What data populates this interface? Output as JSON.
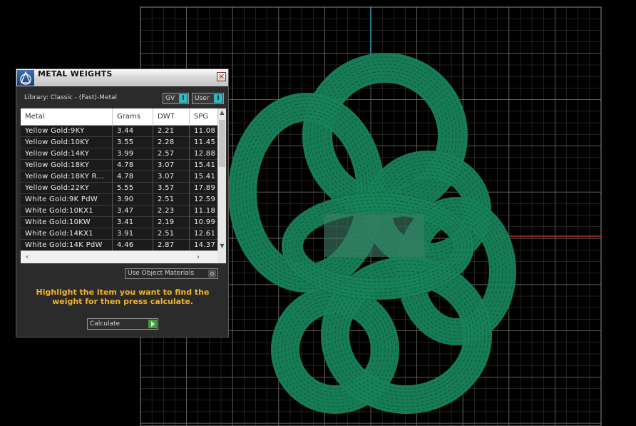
{
  "panel": {
    "title": "METAL WEIGHTS",
    "close_glyph": "✕",
    "library_label": "Library: Classic - (Fast)-Metal",
    "gv_toggle": "GV",
    "user_toggle": "User",
    "columns": [
      "Metal",
      "Grams",
      "DWT",
      "SPG"
    ],
    "rows": [
      [
        "Yellow Gold:9KY",
        "3.44",
        "2.21",
        "11.08"
      ],
      [
        "Yellow Gold:10KY",
        "3.55",
        "2.28",
        "11.45"
      ],
      [
        "Yellow Gold:14KY",
        "3.99",
        "2.57",
        "12.88"
      ],
      [
        "Yellow Gold:18KY",
        "4.78",
        "3.07",
        "15.41"
      ],
      [
        "Yellow Gold:18KY R...",
        "4.78",
        "3.07",
        "15.41"
      ],
      [
        "Yellow Gold:22KY",
        "5.55",
        "3.57",
        "17.89"
      ],
      [
        "White Gold:9K PdW",
        "3.90",
        "2.51",
        "12.59"
      ],
      [
        "White Gold:10KX1",
        "3.47",
        "2.23",
        "11.18"
      ],
      [
        "White Gold:10KW",
        "3.41",
        "2.19",
        "10.99"
      ],
      [
        "White Gold:14KX1",
        "3.91",
        "2.51",
        "12.61"
      ],
      [
        "White Gold:14K PdW",
        "4.46",
        "2.87",
        "14.37"
      ]
    ],
    "use_object_materials": "Use Object Materials",
    "instructions": "Highlight the item you want to find the weight for then press calculate.",
    "calculate_button": "Calculate"
  },
  "viewport": {
    "background_color": "#000000",
    "grid_color": "#6e6e6e",
    "axis_vertical_color": "#2aa7b8",
    "axis_horizontal_color": "#b8321f",
    "model_color": "#17835a",
    "model_icon": "wireframe-pendant-model"
  },
  "colors": {
    "accent_text": "#f1b22a",
    "toggle_knob": "#33b6c3",
    "calculate_arrow": "#3f9e3a"
  }
}
